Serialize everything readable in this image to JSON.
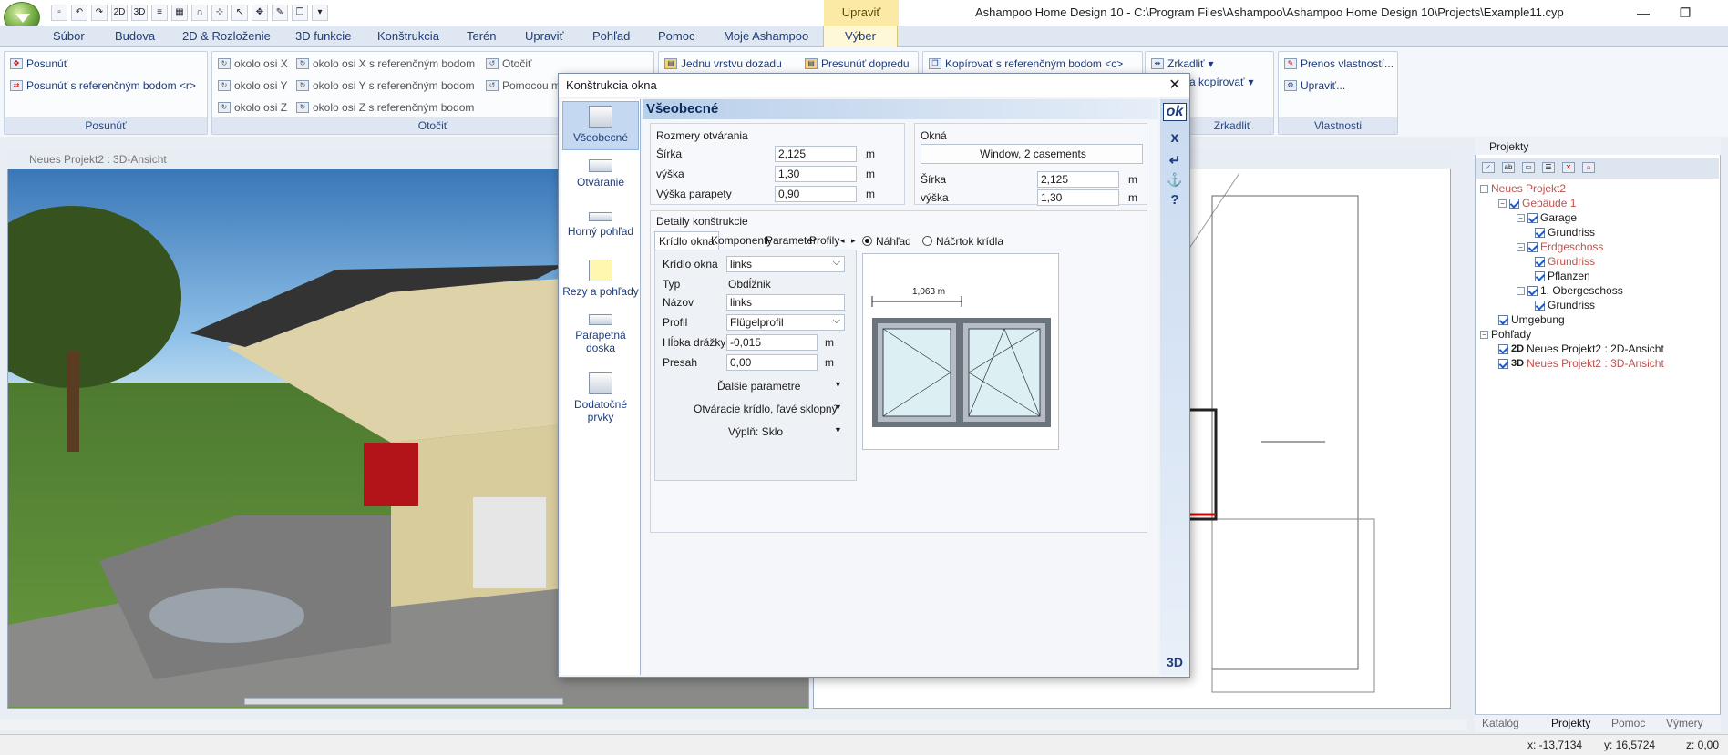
{
  "window": {
    "title": "Ashampoo Home Design 10 - C:\\Program Files\\Ashampoo\\Ashampoo Home Design 10\\Projects\\Example11.cyp",
    "context_tab": "Upraviť"
  },
  "qat": [
    "2D",
    "3D"
  ],
  "menu": [
    "Súbor",
    "Budova",
    "2D & Rozloženie",
    "3D funkcie",
    "Konštrukcia",
    "Terén",
    "Upraviť",
    "Pohľad",
    "Pomoc",
    "Moje Ashampoo",
    "Výber"
  ],
  "ribbon": {
    "posunut": {
      "label": "Posunúť",
      "items": [
        "Posunúť",
        "Posunúť s referenčným bodom <r>"
      ]
    },
    "otocit": {
      "label": "Otočiť",
      "items": [
        "okolo osi X",
        "okolo osi Y",
        "okolo osi Z",
        "okolo osi X s referenčným bodom",
        "okolo osi Y s referenčným bodom",
        "okolo osi Z s referenčným bodom",
        "Otočiť",
        "Pomocou m"
      ]
    },
    "vrstvy": {
      "items": [
        "Jednu vrstvu dozadu",
        "Presunúť dopredu",
        "Kopírovať s referenčným bodom <c>"
      ]
    },
    "zrkadlit": {
      "label": "Zrkadliť",
      "items": [
        "Zrkadliť",
        "a kopírovať"
      ]
    },
    "vlastnosti": {
      "label": "Vlastnosti",
      "items": [
        "Prenos vlastností...",
        "Upraviť..."
      ]
    }
  },
  "views": {
    "view3d_title": "Neues Projekt2 : 3D-Ansicht"
  },
  "projects": {
    "title": "Projekty",
    "tree": [
      {
        "label": "Neues Projekt2",
        "level": 0,
        "red": true
      },
      {
        "label": "Gebäude 1",
        "level": 1,
        "red": true
      },
      {
        "label": "Garage",
        "level": 2,
        "red": false
      },
      {
        "label": "Grundriss",
        "level": 3,
        "red": false
      },
      {
        "label": "Erdgeschoss",
        "level": 2,
        "red": true
      },
      {
        "label": "Grundriss",
        "level": 3,
        "red": true
      },
      {
        "label": "Pflanzen",
        "level": 3,
        "red": false
      },
      {
        "label": "1. Obergeschoss",
        "level": 2,
        "red": false
      },
      {
        "label": "Grundriss",
        "level": 3,
        "red": false
      },
      {
        "label": "Umgebung",
        "level": 1,
        "red": false
      },
      {
        "label": "Pohľady",
        "level": 0,
        "red": false
      },
      {
        "label": "Neues Projekt2 : 2D-Ansicht",
        "level": 1,
        "red": false,
        "prefix": "2D"
      },
      {
        "label": "Neues Projekt2 : 3D-Ansicht",
        "level": 1,
        "red": true,
        "prefix": "3D"
      }
    ],
    "tabs": [
      "Katalóg",
      "Projekty",
      "Pomoc",
      "Výmery"
    ]
  },
  "status": {
    "x": "x: -13,7134",
    "y": "y: 16,5724",
    "z": "z: 0,00"
  },
  "dialog": {
    "title": "Konštrukcia okna",
    "header": "Všeobecné",
    "sidebar": [
      "Všeobecné",
      "Otváranie",
      "Horný pohľad",
      "Rezy a pohľady",
      "Parapetná doska",
      "Dodatočné prvky"
    ],
    "right_buttons": [
      "ok",
      "x",
      "↵",
      "⚓",
      "?",
      "3D"
    ],
    "opening": {
      "legend": "Rozmery otvárania",
      "fields": [
        {
          "label": "Šírka",
          "value": "2,125",
          "unit": "m"
        },
        {
          "label": "výška",
          "value": "1,30",
          "unit": "m"
        },
        {
          "label": "Výška parapety",
          "value": "0,90",
          "unit": "m"
        }
      ]
    },
    "window": {
      "legend": "Okná",
      "type_button": "Window, 2 casements",
      "fields": [
        {
          "label": "Šírka",
          "value": "2,125",
          "unit": "m"
        },
        {
          "label": "výška",
          "value": "1,30",
          "unit": "m"
        }
      ]
    },
    "details": {
      "legend": "Detaily konštrukcie",
      "tabs": [
        "Krídlo okna",
        "Komponenty",
        "Parameter",
        "Profily"
      ],
      "rows": {
        "kridlo": {
          "label": "Krídlo okna",
          "value": "links"
        },
        "typ": {
          "label": "Typ",
          "value": "Obdĺžnik"
        },
        "nazov": {
          "label": "Názov",
          "value": "links"
        },
        "profil": {
          "label": "Profil",
          "value": "Flügelprofil"
        },
        "hlbka": {
          "label": "Hĺbka drážky",
          "value": "-0,015",
          "unit": "m"
        },
        "presah": {
          "label": "Presah",
          "value": "0,00",
          "unit": "m"
        }
      },
      "dropdowns": [
        "Ďalšie parametre",
        "Otváracie krídlo, ľavé sklopný",
        "Výplň: Sklo"
      ],
      "preview_radio": [
        "Náhľad",
        "Náčrtok krídla"
      ],
      "dimension": "1,063 m"
    }
  }
}
